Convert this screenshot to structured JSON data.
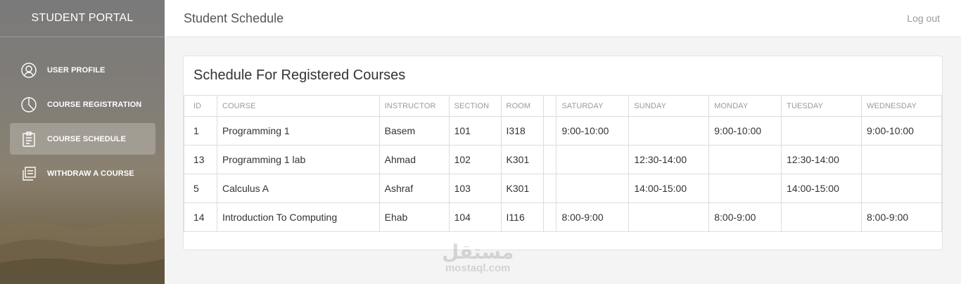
{
  "sidebar": {
    "brand": "STUDENT PORTAL",
    "items": [
      {
        "label": "USER PROFILE",
        "icon": "user-circle-icon"
      },
      {
        "label": "COURSE REGISTRATION",
        "icon": "pie-chart-icon"
      },
      {
        "label": "COURSE SCHEDULE",
        "icon": "clipboard-icon"
      },
      {
        "label": "WITHDRAW A COURSE",
        "icon": "document-stack-icon"
      }
    ],
    "active_item": "COURSE SCHEDULE"
  },
  "topbar": {
    "title": "Student Schedule",
    "logout": "Log out"
  },
  "card": {
    "title": "Schedule For Registered Courses"
  },
  "table": {
    "headers": [
      "ID",
      "COURSE",
      "INSTRUCTOR",
      "SECTION",
      "ROOM",
      "",
      "SATURDAY",
      "SUNDAY",
      "MONDAY",
      "TUESDAY",
      "WEDNESDAY"
    ],
    "rows": [
      [
        "1",
        "Programming 1",
        "Basem",
        "101",
        "I318",
        "",
        "9:00-10:00",
        "",
        "9:00-10:00",
        "",
        "9:00-10:00"
      ],
      [
        "13",
        "Programming 1 lab",
        "Ahmad",
        "102",
        "K301",
        "",
        "",
        "12:30-14:00",
        "",
        "12:30-14:00",
        ""
      ],
      [
        "5",
        "Calculus A",
        "Ashraf",
        "103",
        "K301",
        "",
        "",
        "14:00-15:00",
        "",
        "14:00-15:00",
        ""
      ],
      [
        "14",
        "Introduction To Computing",
        "Ehab",
        "104",
        "I116",
        "",
        "8:00-9:00",
        "",
        "8:00-9:00",
        "",
        "8:00-9:00"
      ]
    ]
  },
  "watermark": {
    "arabic": "مستقل",
    "latin": "mostaql.com"
  },
  "colors": {
    "sidebar_active": "#a8a39d",
    "text_primary": "#333333",
    "text_muted": "#9a9a9a"
  }
}
